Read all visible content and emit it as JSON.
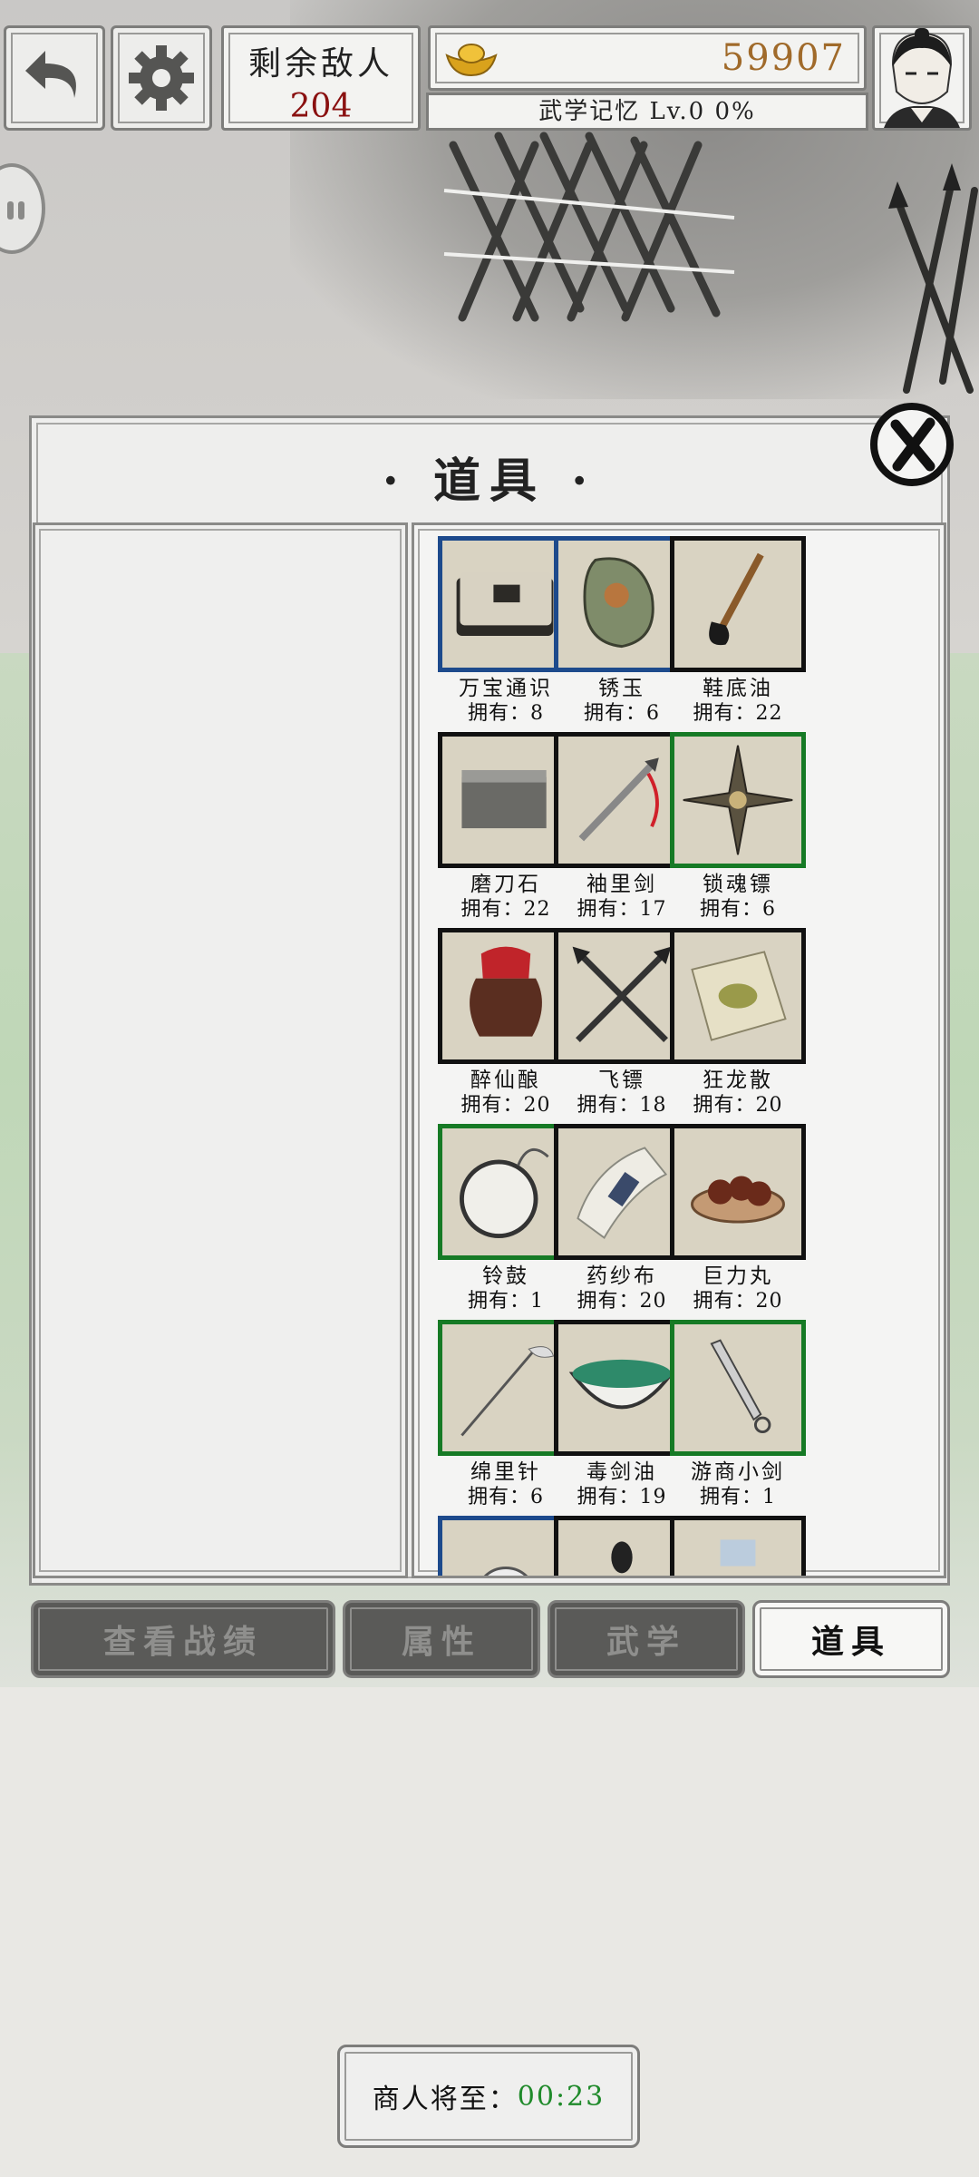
{
  "header": {
    "back_icon": "back-arrow-icon",
    "settings_icon": "gear-icon",
    "enemies_label": "剩余敌人",
    "enemies_count": "204",
    "gold_icon": "gold-ingot-icon",
    "gold_amount": "59907",
    "xp_text": "武学记忆 Lv.0 0%",
    "avatar": "character-portrait"
  },
  "panel": {
    "title": "· 道具 ·",
    "close_icon": "close-x-icon"
  },
  "items": [
    {
      "name": "万宝通识",
      "count": "拥有：8",
      "rarity": "blue",
      "icon": "book-icon"
    },
    {
      "name": "锈玉",
      "count": "拥有：6",
      "rarity": "blue",
      "icon": "jade-icon"
    },
    {
      "name": "鞋底油",
      "count": "拥有：22",
      "rarity": "black",
      "icon": "brush-icon"
    },
    {
      "name": "磨刀石",
      "count": "拥有：22",
      "rarity": "black",
      "icon": "whetstone-icon"
    },
    {
      "name": "袖里剑",
      "count": "拥有：17",
      "rarity": "black",
      "icon": "sword-icon"
    },
    {
      "name": "锁魂镖",
      "count": "拥有：6",
      "rarity": "green",
      "icon": "dart-icon"
    },
    {
      "name": "醉仙酿",
      "count": "拥有：20",
      "rarity": "black",
      "icon": "wine-jar-icon"
    },
    {
      "name": "飞镖",
      "count": "拥有：18",
      "rarity": "black",
      "icon": "crossed-darts-icon"
    },
    {
      "name": "狂龙散",
      "count": "拥有：20",
      "rarity": "black",
      "icon": "powder-icon"
    },
    {
      "name": "铃鼓",
      "count": "拥有：1",
      "rarity": "green",
      "icon": "tambourine-icon"
    },
    {
      "name": "药纱布",
      "count": "拥有：20",
      "rarity": "black",
      "icon": "bandage-icon"
    },
    {
      "name": "巨力丸",
      "count": "拥有：20",
      "rarity": "black",
      "icon": "pills-icon"
    },
    {
      "name": "绵里针",
      "count": "拥有：6",
      "rarity": "green",
      "icon": "needle-icon"
    },
    {
      "name": "毒剑油",
      "count": "拥有：19",
      "rarity": "black",
      "icon": "poison-bowl-icon"
    },
    {
      "name": "游商小剑",
      "count": "拥有：1",
      "rarity": "green",
      "icon": "dagger-icon"
    }
  ],
  "tabs": [
    {
      "label": "查看战绩",
      "active": false
    },
    {
      "label": "属性",
      "active": false
    },
    {
      "label": "武学",
      "active": false
    },
    {
      "label": "道具",
      "active": true
    }
  ],
  "merchant": {
    "label": "商人将至：",
    "timer": "00:23"
  },
  "colors": {
    "blue_rarity": "#1d4a8c",
    "green_rarity": "#167a25",
    "enemy_count": "#8a1010",
    "gold": "#a06a2a",
    "timer": "#1f8a2a"
  }
}
